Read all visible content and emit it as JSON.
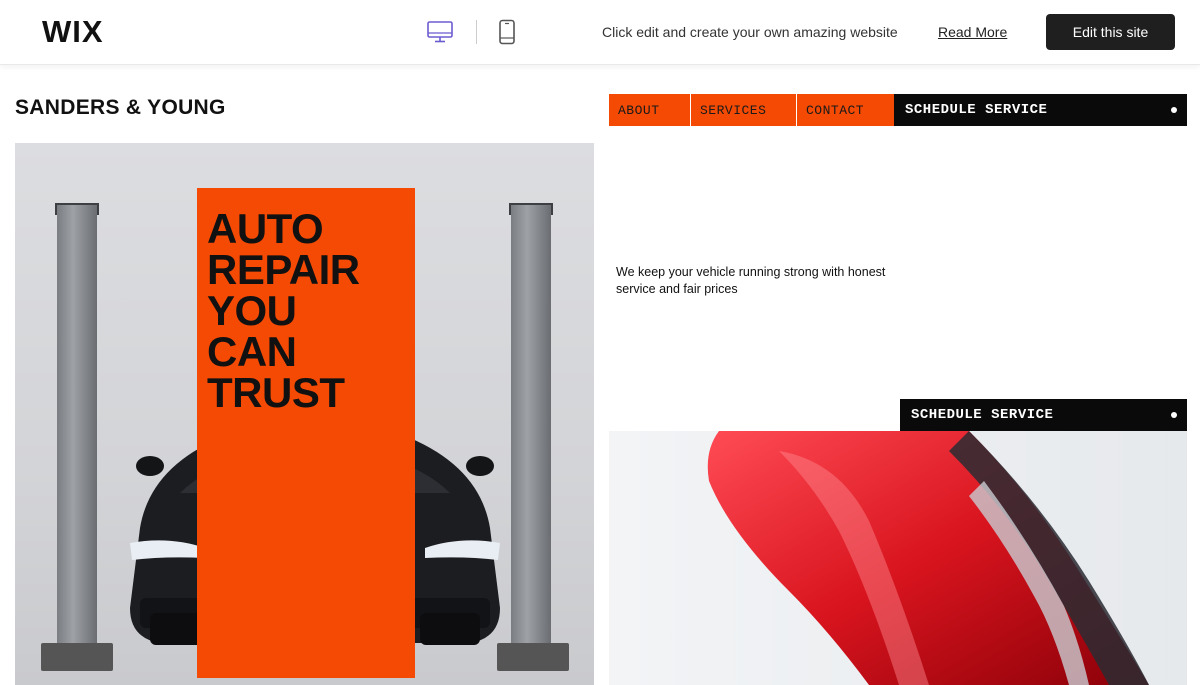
{
  "wix_bar": {
    "logo": "WIX",
    "promo_text": "Click edit and create your own amazing website",
    "read_more": "Read More",
    "edit_button": "Edit this site",
    "icons": [
      "desktop-icon",
      "mobile-icon"
    ],
    "accent_color": "#6b5bd1"
  },
  "site": {
    "brand": "SANDERS & YOUNG",
    "nav": {
      "items": [
        "ABOUT",
        "SERVICES",
        "CONTACT"
      ],
      "schedule_label": "SCHEDULE SERVICE"
    },
    "hero": {
      "headline": [
        "AUTO",
        "REPAIR",
        "YOU",
        "CAN",
        "TRUST"
      ]
    },
    "tagline": "We keep your vehicle running strong with honest service and fair prices",
    "schedule_secondary": "SCHEDULE SERVICE",
    "colors": {
      "accent_orange": "#f44a03",
      "black": "#0a0a0a",
      "white": "#ffffff"
    }
  }
}
